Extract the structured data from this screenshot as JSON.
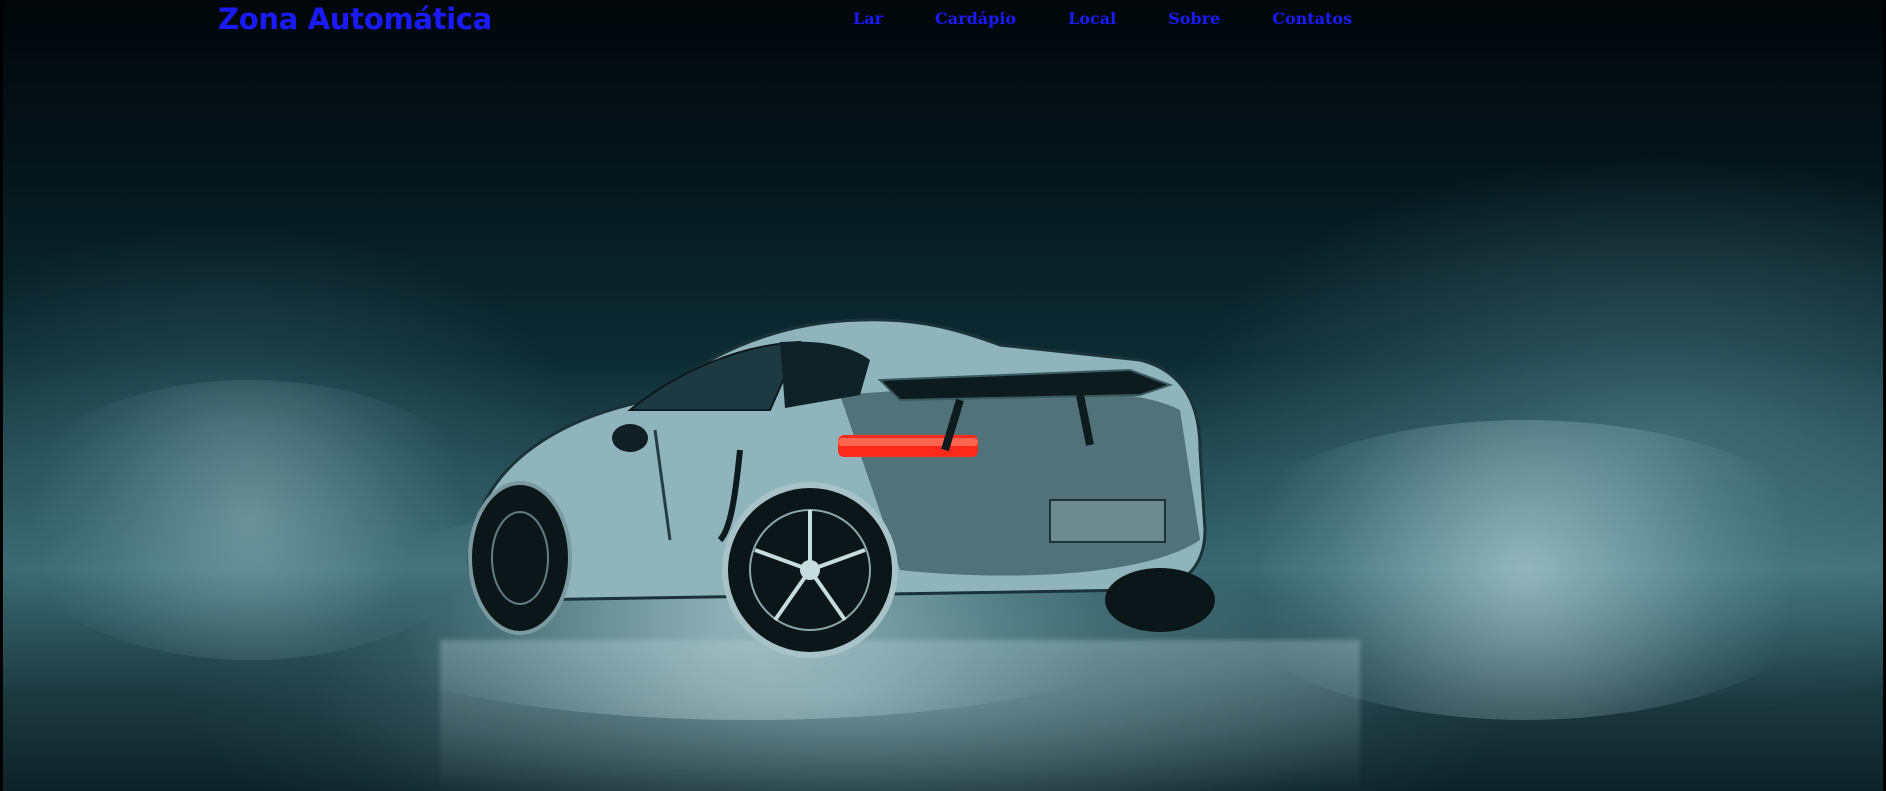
{
  "header": {
    "brand": "Zona Automática",
    "nav": [
      {
        "label": "Lar"
      },
      {
        "label": "Cardápio"
      },
      {
        "label": "Local"
      },
      {
        "label": "Sobre"
      },
      {
        "label": "Contatos"
      }
    ]
  },
  "hero": {
    "image": "sports-car-in-rain",
    "colors": {
      "link": "#1a1aff",
      "background": "#031015",
      "taillight": "#ff2a1a"
    }
  }
}
